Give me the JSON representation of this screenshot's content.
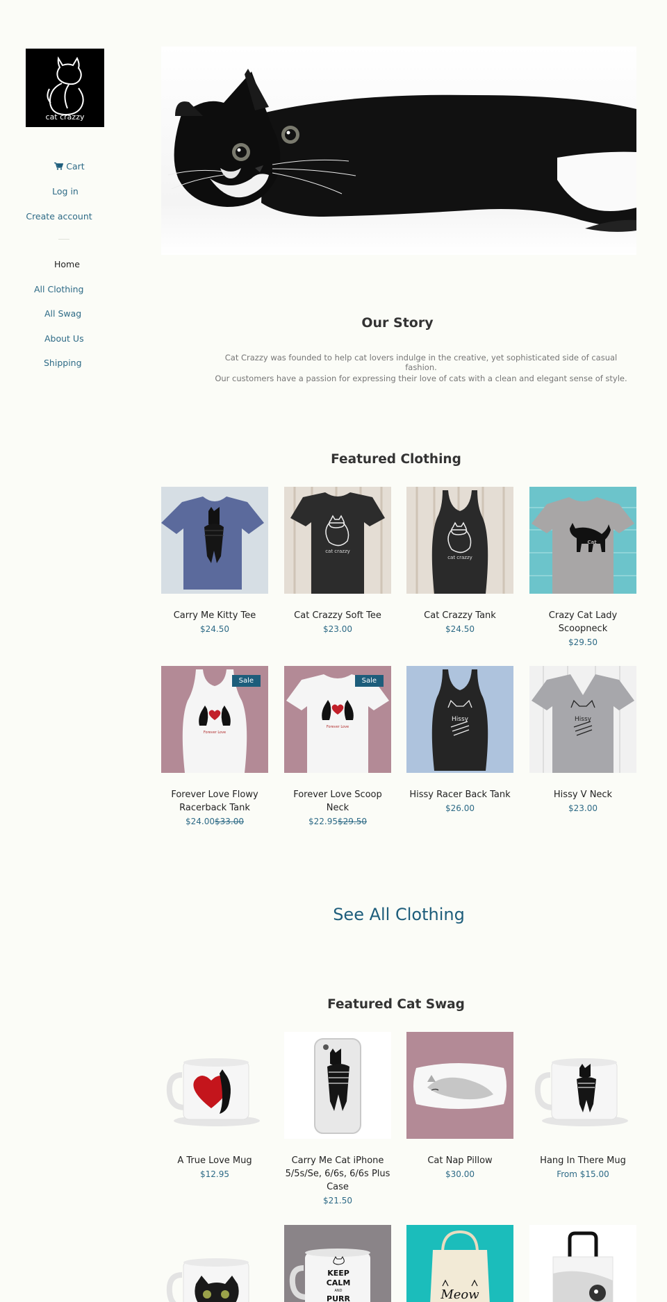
{
  "brand": {
    "logo_text": "cat crazzy"
  },
  "account_links": {
    "cart": "Cart",
    "login": "Log in",
    "create_account": "Create account"
  },
  "nav": [
    {
      "label": "Home",
      "active": true
    },
    {
      "label": "All Clothing",
      "active": false
    },
    {
      "label": "All Swag",
      "active": false
    },
    {
      "label": "About Us",
      "active": false
    },
    {
      "label": "Shipping",
      "active": false
    }
  ],
  "story": {
    "title": "Our Story",
    "p1": "Cat Crazzy was founded to help cat lovers indulge in the creative, yet sophisticated side of casual fashion.",
    "p2": "Our customers have a passion for expressing their love of cats with a clean and elegant sense of style."
  },
  "featured_clothing": {
    "title": "Featured Clothing",
    "products": [
      {
        "name": "Carry Me Kitty Tee",
        "price": "$24.50"
      },
      {
        "name": "Cat Crazzy Soft Tee",
        "price": "$23.00"
      },
      {
        "name": "Cat Crazzy Tank",
        "price": "$24.50"
      },
      {
        "name": "Crazy Cat Lady Scoopneck",
        "price": "$29.50"
      },
      {
        "name": "Forever Love Flowy Racerback Tank",
        "price": "$24.00",
        "compare_price": "$33.00",
        "badge": "Sale"
      },
      {
        "name": "Forever Love Scoop Neck",
        "price": "$22.95",
        "compare_price": "$29.50",
        "badge": "Sale"
      },
      {
        "name": "Hissy Racer Back Tank",
        "price": "$26.00"
      },
      {
        "name": "Hissy V Neck",
        "price": "$23.00"
      }
    ]
  },
  "see_all_label": "See All Clothing",
  "featured_swag": {
    "title": "Featured Cat Swag",
    "products": [
      {
        "name": "A True Love Mug",
        "price": "$12.95"
      },
      {
        "name": "Carry Me Cat iPhone 5/5s/Se, 6/6s, 6/6s Plus Case",
        "price": "$21.50"
      },
      {
        "name": "Cat Nap Pillow",
        "price": "$30.00"
      },
      {
        "name": "Hang In There Mug",
        "price": "From $15.00"
      }
    ],
    "partial_image_texts": {
      "keep_calm": "KEEP CALM AND PURR",
      "meow": "Meow"
    }
  },
  "colors": {
    "background": "#fbfcf7",
    "link": "#1d5d7b",
    "sale_badge": "#1d5d7b"
  }
}
